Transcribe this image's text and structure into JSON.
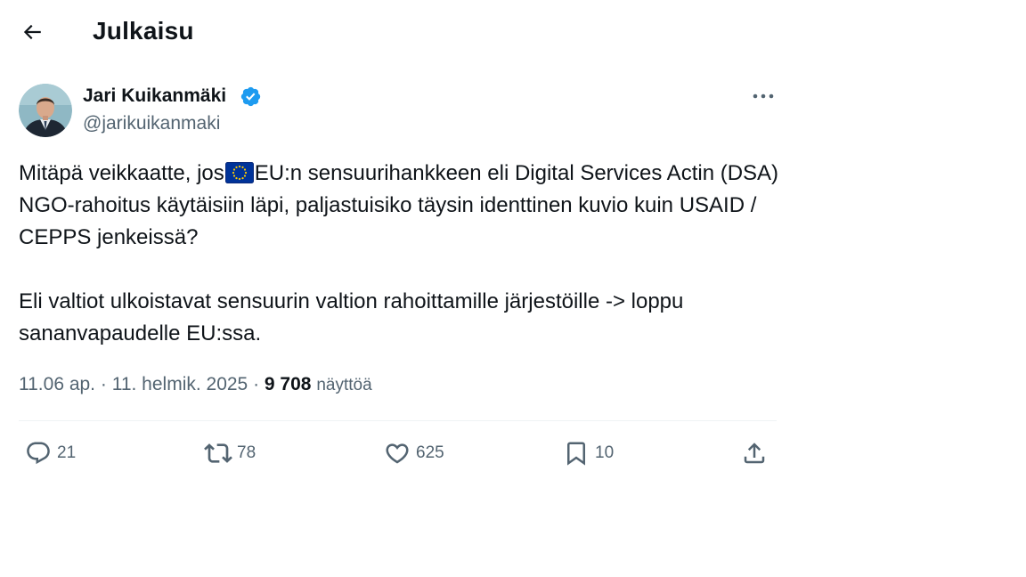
{
  "header": {
    "title": "Julkaisu",
    "back_icon": "arrow-left-icon"
  },
  "author": {
    "name": "Jari Kuikanmäki",
    "handle": "@jarikuikanmaki",
    "verified": true,
    "badge_color": "#1d9bf0"
  },
  "tweet": {
    "paragraph1_before_flag": "Mitäpä veikkaatte, jos",
    "flag_emoji": "eu-flag-icon",
    "paragraph1_after_flag": "EU:n sensuurihankkeen eli Digital Services Actin (DSA) NGO-rahoitus käytäisiin läpi, paljastuisiko täysin identtinen kuvio kuin USAID / CEPPS jenkeissä?",
    "paragraph2": "Eli valtiot ulkoistavat sensuurin valtion rahoittamille järjestöille -> loppu sananvapaudelle EU:ssa."
  },
  "meta": {
    "time": "11.06 ap.",
    "separator": " · ",
    "date": "11. helmik. 2025",
    "views_count": "9 708",
    "views_label": "näyttöä"
  },
  "actions": {
    "replies": "21",
    "reposts": "78",
    "likes": "625",
    "bookmarks": "10"
  },
  "colors": {
    "text": "#0f1419",
    "secondary": "#536471",
    "divider": "#eff3f4",
    "accent": "#1d9bf0"
  }
}
